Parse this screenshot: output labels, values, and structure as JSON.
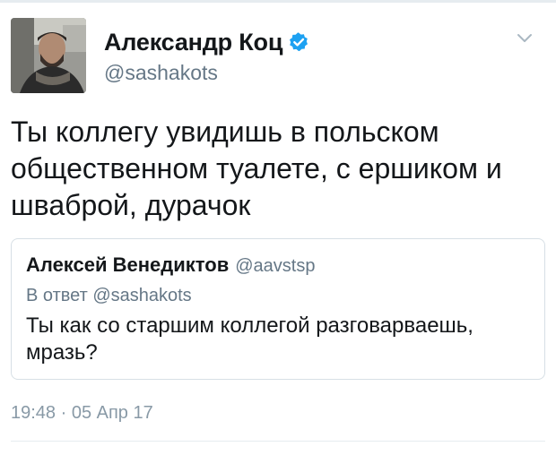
{
  "tweet": {
    "author": {
      "name": "Александр Коц",
      "handle": "@sashakots",
      "verified": true
    },
    "text": "Ты коллегу увидишь в польском общественном туалете, с ершиком и шваброй, дурачок",
    "timestamp": "19:48 · 05 Апр 17",
    "menu_icon": "chevron-down-icon"
  },
  "quoted_tweet": {
    "author_name": "Алексей Венедиктов",
    "author_handle": "@aavstsp",
    "reply_to": "В ответ @sashakots",
    "text": "Ты как со старшим коллегой разговарваешь, мразь?"
  },
  "colors": {
    "verified_badge": "#1da1f2",
    "secondary_text": "#657786",
    "primary_text": "#14171a",
    "border": "#d7dfe5"
  }
}
